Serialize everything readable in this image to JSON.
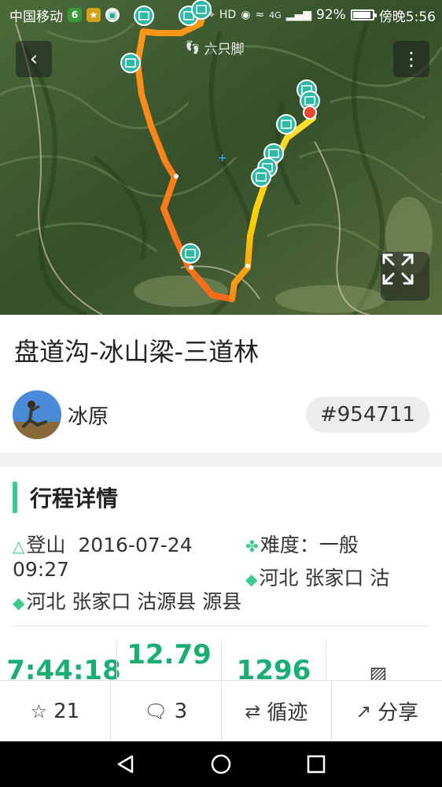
{
  "status_bar": {
    "carrier": "中国移动",
    "signal_label": "4G",
    "battery": "92%",
    "time": "傍晚5:56"
  },
  "map": {
    "watermark": "六只脚",
    "icons": {
      "back": "back-arrow-icon",
      "more": "more-vertical-icon",
      "expand": "expand-icon",
      "photo": "photo-marker-icon"
    },
    "colors": {
      "route_start": "#ffd000",
      "route_mid": "#ff9a1a",
      "route_end": "#ff6a1a",
      "marker": "#2fb9a5"
    }
  },
  "trip": {
    "title": "盘道沟-冰山梁-三道林",
    "author": "冰原",
    "id": "#954711"
  },
  "details": {
    "section_title": "行程详情",
    "date_label": "登山",
    "date": "2016-07-24",
    "time": "09:27",
    "difficulty_label": "难度：",
    "difficulty": "一般",
    "end_location": "河北  张家口  沽",
    "start_location": "河北  张家口  沽源县 源县"
  },
  "stats": {
    "duration": "7:44:18",
    "distance": "12.79",
    "elevation": "1296"
  },
  "actions": {
    "favorite_count": "21",
    "comment_count": "3",
    "follow_label": "循迹",
    "share_label": "分享"
  },
  "colors": {
    "accent": "#3ccb8a",
    "stat_green": "#1aae72"
  }
}
